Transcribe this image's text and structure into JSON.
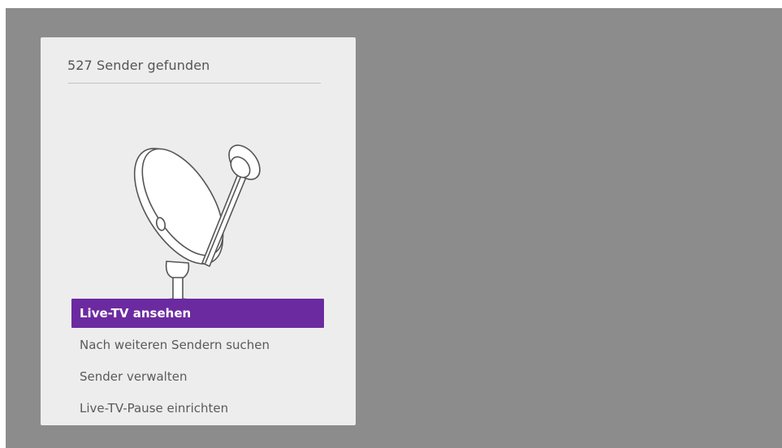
{
  "dialog": {
    "title": "527 Sender gefunden"
  },
  "illustration": {
    "icon": "satellite-dish-icon"
  },
  "menu": {
    "items": [
      {
        "label": "Live-TV ansehen",
        "selected": true
      },
      {
        "label": "Nach weiteren Sendern suchen",
        "selected": false
      },
      {
        "label": "Sender verwalten",
        "selected": false
      },
      {
        "label": "Live-TV-Pause einrichten",
        "selected": false
      }
    ]
  },
  "colors": {
    "accent": "#6c2aa0",
    "background": "#8c8c8c",
    "panel": "#ededed"
  }
}
